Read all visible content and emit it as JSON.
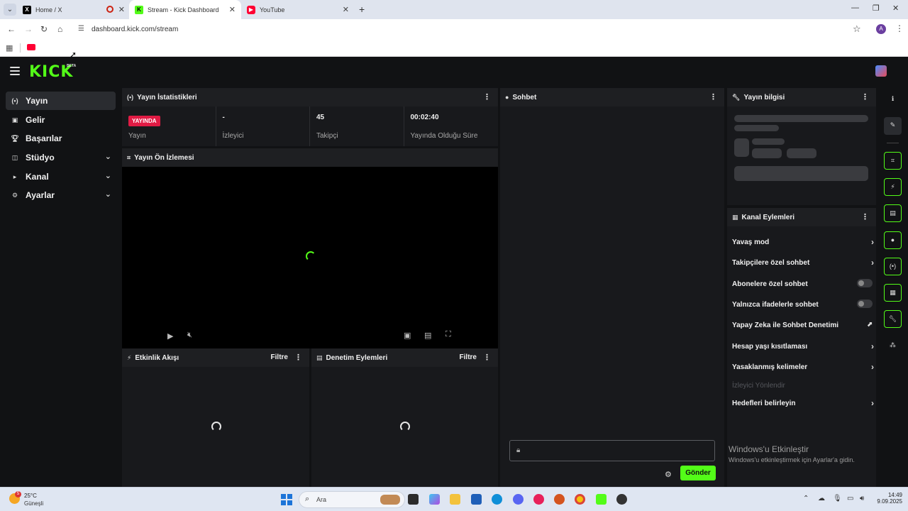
{
  "browser": {
    "tabs": [
      {
        "title": "Home / X"
      },
      {
        "title": "Stream - Kick Dashboard"
      },
      {
        "title": "YouTube"
      }
    ],
    "url": "dashboard.kick.com/stream",
    "profile_initial": "A"
  },
  "brand": {
    "logo": "KICK",
    "beta": "BETA",
    "accent": "#53fc18"
  },
  "sidebar": {
    "items": [
      {
        "label": "Yayın",
        "icon": "broadcast-icon"
      },
      {
        "label": "Gelir",
        "icon": "revenue-icon"
      },
      {
        "label": "Başarılar",
        "icon": "trophy-icon"
      },
      {
        "label": "Stüdyo",
        "icon": "studio-icon"
      },
      {
        "label": "Kanal",
        "icon": "channel-icon"
      },
      {
        "label": "Ayarlar",
        "icon": "gear-icon"
      }
    ]
  },
  "stats": {
    "title": "Yayın İstatistikleri",
    "live_badge": "YAYINDA",
    "items": [
      {
        "value": "",
        "label": "Yayın"
      },
      {
        "value": "-",
        "label": "İzleyici"
      },
      {
        "value": "45",
        "label": "Takipçi"
      },
      {
        "value": "00:02:40",
        "label": "Yayında Olduğu Süre"
      }
    ]
  },
  "preview": {
    "title": "Yayın Ön İzlemesi"
  },
  "activity": {
    "title": "Etkinlik Akışı",
    "filter": "Filtre"
  },
  "moderation": {
    "title": "Denetim Eylemleri",
    "filter": "Filtre"
  },
  "chat": {
    "title": "Sohbet",
    "send_label": "Gönder"
  },
  "stream_info": {
    "title": "Yayın bilgisi"
  },
  "channel_actions": {
    "title": "Kanal Eylemleri",
    "items": [
      {
        "label": "Yavaş mod",
        "control": "arrow"
      },
      {
        "label": "Takipçilere özel sohbet",
        "control": "arrow"
      },
      {
        "label": "Abonelere özel sohbet",
        "control": "toggle"
      },
      {
        "label": "Yalnızca ifadelerle sohbet",
        "control": "toggle"
      },
      {
        "label": "Yapay Zeka ile Sohbet Denetimi",
        "control": "external"
      },
      {
        "label": "Hesap yaşı kısıtlaması",
        "control": "arrow"
      },
      {
        "label": "Yasaklanmış kelimeler",
        "control": "arrow"
      },
      {
        "label": "İzleyici Yönlendir",
        "control": "none",
        "disabled": true
      },
      {
        "label": "Hedefleri belirleyin",
        "control": "arrow"
      }
    ]
  },
  "windows_activation": {
    "title": "Windows'u Etkinleştir",
    "subtitle": "Windows'u etkinleştirmek için Ayarlar'a gidin."
  },
  "taskbar": {
    "temperature": "25°C",
    "condition": "Güneşli",
    "weather_badge": "5",
    "search_placeholder": "Ara",
    "time": "14:49",
    "date": "9.09.2025"
  }
}
